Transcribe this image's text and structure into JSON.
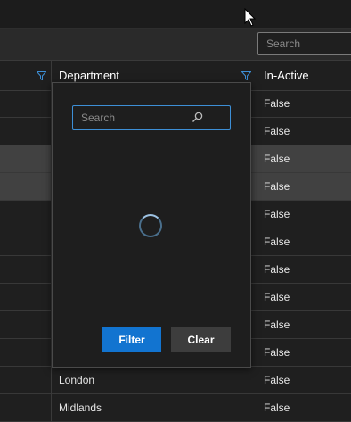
{
  "toolbar": {
    "search_placeholder": "Search"
  },
  "grid": {
    "columns": [
      {
        "label": ""
      },
      {
        "label": "Department"
      },
      {
        "label": "In-Active"
      }
    ],
    "rows": [
      {
        "department": "",
        "inactive": "False",
        "selected": false
      },
      {
        "department": "",
        "inactive": "False",
        "selected": false
      },
      {
        "department": "",
        "inactive": "False",
        "selected": true
      },
      {
        "department": "",
        "inactive": "False",
        "selected": true
      },
      {
        "department": "",
        "inactive": "False",
        "selected": false
      },
      {
        "department": "",
        "inactive": "False",
        "selected": false
      },
      {
        "department": "",
        "inactive": "False",
        "selected": false
      },
      {
        "department": "",
        "inactive": "False",
        "selected": false
      },
      {
        "department": "",
        "inactive": "False",
        "selected": false
      },
      {
        "department": "",
        "inactive": "False",
        "selected": false
      },
      {
        "department": "London",
        "inactive": "False",
        "selected": false
      },
      {
        "department": "Midlands",
        "inactive": "False",
        "selected": false
      }
    ]
  },
  "filter_popup": {
    "search_placeholder": "Search",
    "filter_label": "Filter",
    "clear_label": "Clear"
  },
  "colors": {
    "accent": "#1274d0",
    "filter_icon": "#3d8fd6",
    "selected_row": "#414141"
  }
}
